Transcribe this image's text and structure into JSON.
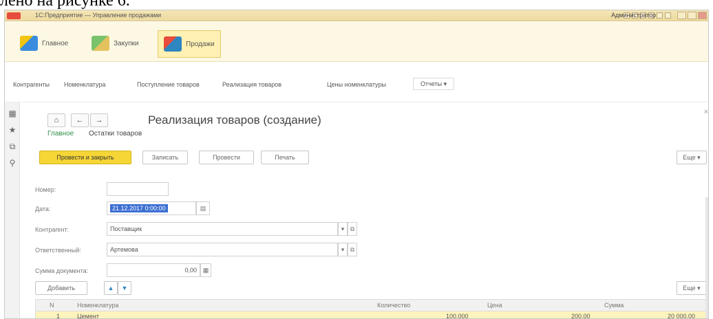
{
  "doc_text": "лено на рисунке 6.",
  "window": {
    "title": "1С:Предприятие — Управление продажами",
    "user": "Администратор"
  },
  "sections": [
    {
      "label": "Главное",
      "icon": "home-icon"
    },
    {
      "label": "Закупки",
      "icon": "cart-icon"
    },
    {
      "label": "Продажи",
      "icon": "sales-icon"
    }
  ],
  "nav_links": [
    "Контрагенты",
    "Номенклатура",
    "Поступление товаров",
    "Реализация товаров",
    "Цены номенклатуры"
  ],
  "reports_label": "Отчеты ▾",
  "left_panel_icons": [
    "grid-icon",
    "star-icon",
    "history-icon",
    "search-icon"
  ],
  "form": {
    "nav": {
      "home": "⌂",
      "back": "←",
      "forward": "→"
    },
    "title": "Реализация товаров (создание)",
    "tabs": [
      "Главное",
      "Остатки товаров"
    ],
    "buttons": {
      "post_close": "Провести и закрыть",
      "write": "Записать",
      "post": "Провести",
      "print": "Печать",
      "more": "Еще ▾"
    },
    "fields": {
      "number_label": "Номер:",
      "number_value": "",
      "date_label": "Дата:",
      "date_value": "21.12.2017 0:00:00",
      "counterparty_label": "Контрагент:",
      "counterparty_value": "Поставщик",
      "responsible_label": "Ответственный:",
      "responsible_value": "Артемова",
      "sum_label": "Сумма документа:",
      "sum_value": "0,00"
    },
    "table_toolbar": {
      "add": "Добавить",
      "up": "▲",
      "down": "▼",
      "more": "Еще ▾"
    },
    "table": {
      "headers": [
        "N",
        "Номенклатура",
        "Количество",
        "Цена",
        "Сумма"
      ],
      "rows": [
        {
          "n": "1",
          "item": "Цемент",
          "qty": "100,000",
          "price": "200,00",
          "sum": "20 000,00"
        }
      ]
    }
  }
}
